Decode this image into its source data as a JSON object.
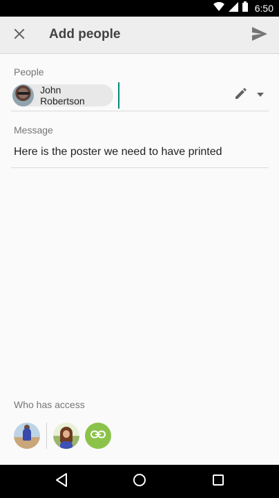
{
  "status_bar": {
    "time": "6:50",
    "icons": [
      "wifi-icon",
      "signal-icon",
      "battery-icon"
    ]
  },
  "app_bar": {
    "title": "Add people",
    "close_icon": "close-icon",
    "send_icon": "send-icon"
  },
  "people": {
    "label": "People",
    "chips": [
      {
        "name": "John Robertson",
        "avatar": "avatar"
      }
    ],
    "edit_icon": "pencil-icon",
    "dropdown_icon": "arrow-drop-down-icon"
  },
  "message": {
    "label": "Message",
    "value": "Here is the poster we need to have printed"
  },
  "access": {
    "label": "Who has access",
    "link_icon": "link-icon"
  },
  "nav_bar": {
    "icons": [
      "back-icon",
      "home-icon",
      "recents-icon"
    ]
  },
  "colors": {
    "accent_cursor": "#00897b",
    "link_button": "#8bc34a",
    "app_bar_bg": "#eeeeee"
  }
}
